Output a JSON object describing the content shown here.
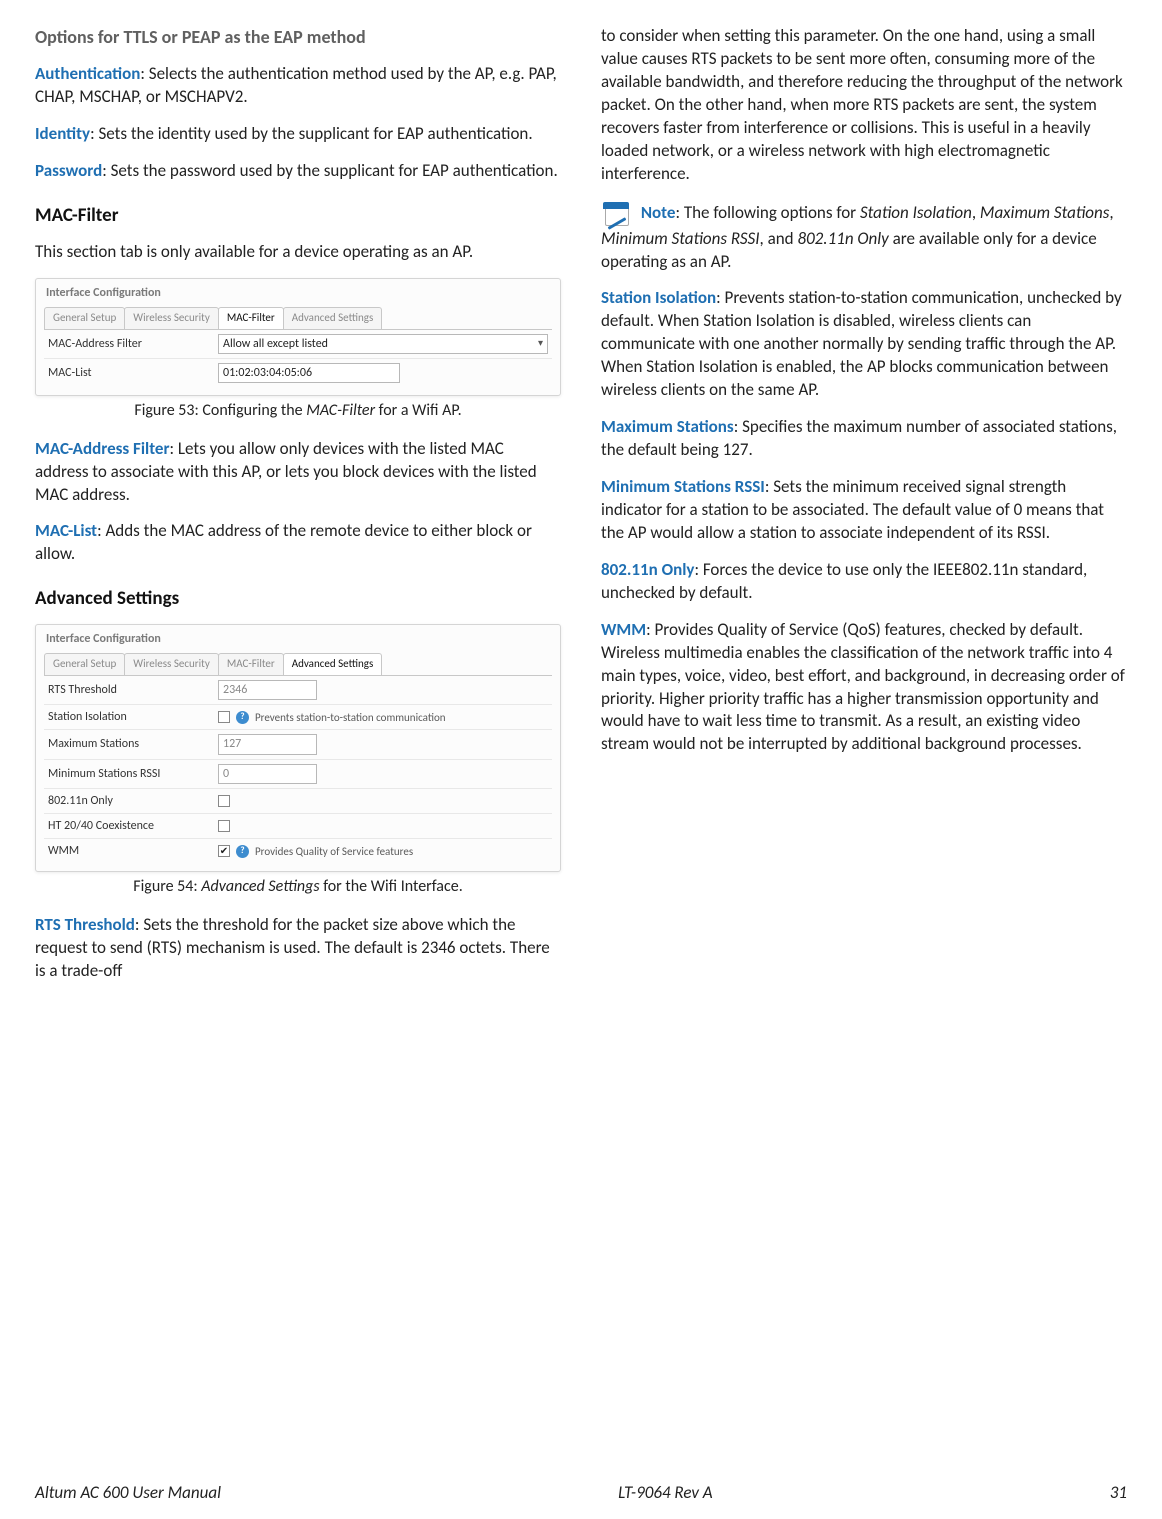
{
  "left": {
    "options_heading": "Options for TTLS or PEAP as the EAP method",
    "auth_term": "Authentication",
    "auth_text": ": Selects the authentication method used by the AP, e.g. PAP, CHAP, MSCHAP, or MSCHAPV2.",
    "identity_term": "Identity",
    "identity_text": ": Sets the identity used by the supplicant for EAP authentication.",
    "password_term": "Password",
    "password_text": ": Sets the password used by the supplicant for EAP authentication.",
    "macfilter_heading": "MAC-Filter",
    "macfilter_intro": "This section tab is only available for a device operating as an AP.",
    "fig53": {
      "legend": "Interface Configuration",
      "tabs": [
        "General Setup",
        "Wireless Security",
        "MAC-Filter",
        "Advanced Settings"
      ],
      "row1_label": "MAC-Address Filter",
      "row1_value": "Allow all except listed",
      "row2_label": "MAC-List",
      "row2_value": "01:02:03:04:05:06",
      "caption_pre": "Figure 53: Configuring the ",
      "caption_it": "MAC-Filter",
      "caption_post": " for a Wifi AP."
    },
    "macaddr_term": "MAC-Address Filter",
    "macaddr_text": ": Lets you allow only devices with the listed MAC address to associate with this AP, or lets you block devices with the listed MAC address.",
    "maclist_term": "MAC-List",
    "maclist_text": ": Adds the MAC address of the remote device to either block or allow.",
    "adv_heading": "Advanced Settings",
    "fig54": {
      "legend": "Interface Configuration",
      "tabs": [
        "General Setup",
        "Wireless Security",
        "MAC-Filter",
        "Advanced Settings"
      ],
      "rows": [
        {
          "label": "RTS Threshold",
          "value": "2346",
          "type": "text"
        },
        {
          "label": "Station Isolation",
          "type": "check",
          "checked": false,
          "hint": "Prevents station-to-station communication"
        },
        {
          "label": "Maximum Stations",
          "value": "127",
          "type": "text"
        },
        {
          "label": "Minimum Stations RSSI",
          "value": "0",
          "type": "text"
        },
        {
          "label": "802.11n Only",
          "type": "check",
          "checked": false
        },
        {
          "label": "HT 20/40 Coexistence",
          "type": "check",
          "checked": false
        },
        {
          "label": "WMM",
          "type": "check",
          "checked": true,
          "hint": "Provides Quality of Service features"
        }
      ],
      "caption_pre": "Figure 54: ",
      "caption_it": "Advanced Settings",
      "caption_post": " for the Wifi Interface."
    },
    "rts_term": "RTS Threshold",
    "rts_text": ": Sets the threshold for the packet size above which the request to send (RTS) mechanism is used. The default is 2346 octets. There is a trade-off"
  },
  "right": {
    "rts_cont": "to consider when setting this parameter. On the one hand, using a small value causes RTS packets to be sent more often, consuming more of the available bandwidth, and therefore reducing the throughput of the network packet. On the other hand, when more RTS packets are sent, the system recovers faster from interference or collisions. This is useful in a heavily loaded network, or a wireless network with high electromagnetic interference.",
    "note_term": "Note",
    "note_text_1": ": The following options for ",
    "note_it_1": "Station Isolation",
    "note_text_2": ", ",
    "note_it_2": "Maximum Stations",
    "note_text_3": ", ",
    "note_it_3": "Minimum Stations RSSI",
    "note_text_4": ", and ",
    "note_it_4": "802.11n Only",
    "note_text_5": " are available only for a device operating as an AP.",
    "si_term": "Station Isolation",
    "si_text": ": Prevents station-to-station communication, unchecked by default. When Station Isolation is disabled, wireless clients can communicate with one another normally by sending traffic through the AP. When Station Isolation is enabled, the AP blocks communication between wireless clients on the same AP.",
    "max_term": "Maximum Stations",
    "max_text": ": Specifies the maximum number of associated stations, the default being 127.",
    "rssi_term": "Minimum Stations RSSI",
    "rssi_text": ": Sets the minimum received signal strength indicator for a station to be associated. The default value of 0 means that the AP would allow a station to associate independent of its RSSI.",
    "n_term": "802.11n Only",
    "n_text": ": Forces the device to use only the IEEE802.11n standard, unchecked by default.",
    "wmm_term": "WMM",
    "wmm_text": ": Provides Quality of Service (QoS) features, checked by default. Wireless multimedia enables the classification of the network traffic into 4 main types, voice, video, best effort, and background, in decreasing order of priority. Higher priority traffic has a higher transmission opportunity and would have to wait less time to transmit. As a result, an existing video stream would not be interrupted by additional background processes."
  },
  "footer": {
    "left": "Altum AC 600 User Manual",
    "center": "LT-9064 Rev A",
    "right": "31"
  }
}
